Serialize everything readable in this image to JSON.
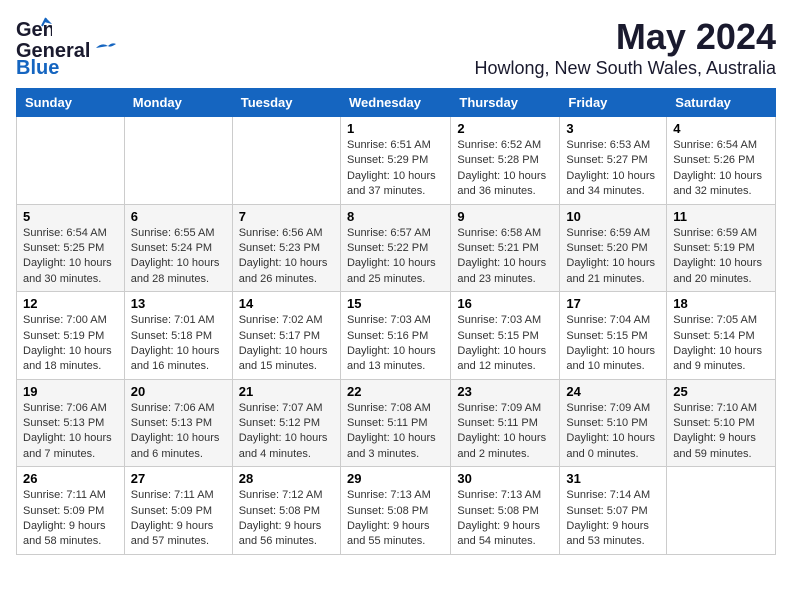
{
  "header": {
    "logo_line1": "General",
    "logo_line2": "Blue",
    "title": "May 2024",
    "subtitle": "Howlong, New South Wales, Australia"
  },
  "columns": [
    "Sunday",
    "Monday",
    "Tuesday",
    "Wednesday",
    "Thursday",
    "Friday",
    "Saturday"
  ],
  "weeks": [
    [
      {
        "day": "",
        "info": ""
      },
      {
        "day": "",
        "info": ""
      },
      {
        "day": "",
        "info": ""
      },
      {
        "day": "1",
        "info": "Sunrise: 6:51 AM\nSunset: 5:29 PM\nDaylight: 10 hours\nand 37 minutes."
      },
      {
        "day": "2",
        "info": "Sunrise: 6:52 AM\nSunset: 5:28 PM\nDaylight: 10 hours\nand 36 minutes."
      },
      {
        "day": "3",
        "info": "Sunrise: 6:53 AM\nSunset: 5:27 PM\nDaylight: 10 hours\nand 34 minutes."
      },
      {
        "day": "4",
        "info": "Sunrise: 6:54 AM\nSunset: 5:26 PM\nDaylight: 10 hours\nand 32 minutes."
      }
    ],
    [
      {
        "day": "5",
        "info": "Sunrise: 6:54 AM\nSunset: 5:25 PM\nDaylight: 10 hours\nand 30 minutes."
      },
      {
        "day": "6",
        "info": "Sunrise: 6:55 AM\nSunset: 5:24 PM\nDaylight: 10 hours\nand 28 minutes."
      },
      {
        "day": "7",
        "info": "Sunrise: 6:56 AM\nSunset: 5:23 PM\nDaylight: 10 hours\nand 26 minutes."
      },
      {
        "day": "8",
        "info": "Sunrise: 6:57 AM\nSunset: 5:22 PM\nDaylight: 10 hours\nand 25 minutes."
      },
      {
        "day": "9",
        "info": "Sunrise: 6:58 AM\nSunset: 5:21 PM\nDaylight: 10 hours\nand 23 minutes."
      },
      {
        "day": "10",
        "info": "Sunrise: 6:59 AM\nSunset: 5:20 PM\nDaylight: 10 hours\nand 21 minutes."
      },
      {
        "day": "11",
        "info": "Sunrise: 6:59 AM\nSunset: 5:19 PM\nDaylight: 10 hours\nand 20 minutes."
      }
    ],
    [
      {
        "day": "12",
        "info": "Sunrise: 7:00 AM\nSunset: 5:19 PM\nDaylight: 10 hours\nand 18 minutes."
      },
      {
        "day": "13",
        "info": "Sunrise: 7:01 AM\nSunset: 5:18 PM\nDaylight: 10 hours\nand 16 minutes."
      },
      {
        "day": "14",
        "info": "Sunrise: 7:02 AM\nSunset: 5:17 PM\nDaylight: 10 hours\nand 15 minutes."
      },
      {
        "day": "15",
        "info": "Sunrise: 7:03 AM\nSunset: 5:16 PM\nDaylight: 10 hours\nand 13 minutes."
      },
      {
        "day": "16",
        "info": "Sunrise: 7:03 AM\nSunset: 5:15 PM\nDaylight: 10 hours\nand 12 minutes."
      },
      {
        "day": "17",
        "info": "Sunrise: 7:04 AM\nSunset: 5:15 PM\nDaylight: 10 hours\nand 10 minutes."
      },
      {
        "day": "18",
        "info": "Sunrise: 7:05 AM\nSunset: 5:14 PM\nDaylight: 10 hours\nand 9 minutes."
      }
    ],
    [
      {
        "day": "19",
        "info": "Sunrise: 7:06 AM\nSunset: 5:13 PM\nDaylight: 10 hours\nand 7 minutes."
      },
      {
        "day": "20",
        "info": "Sunrise: 7:06 AM\nSunset: 5:13 PM\nDaylight: 10 hours\nand 6 minutes."
      },
      {
        "day": "21",
        "info": "Sunrise: 7:07 AM\nSunset: 5:12 PM\nDaylight: 10 hours\nand 4 minutes."
      },
      {
        "day": "22",
        "info": "Sunrise: 7:08 AM\nSunset: 5:11 PM\nDaylight: 10 hours\nand 3 minutes."
      },
      {
        "day": "23",
        "info": "Sunrise: 7:09 AM\nSunset: 5:11 PM\nDaylight: 10 hours\nand 2 minutes."
      },
      {
        "day": "24",
        "info": "Sunrise: 7:09 AM\nSunset: 5:10 PM\nDaylight: 10 hours\nand 0 minutes."
      },
      {
        "day": "25",
        "info": "Sunrise: 7:10 AM\nSunset: 5:10 PM\nDaylight: 9 hours\nand 59 minutes."
      }
    ],
    [
      {
        "day": "26",
        "info": "Sunrise: 7:11 AM\nSunset: 5:09 PM\nDaylight: 9 hours\nand 58 minutes."
      },
      {
        "day": "27",
        "info": "Sunrise: 7:11 AM\nSunset: 5:09 PM\nDaylight: 9 hours\nand 57 minutes."
      },
      {
        "day": "28",
        "info": "Sunrise: 7:12 AM\nSunset: 5:08 PM\nDaylight: 9 hours\nand 56 minutes."
      },
      {
        "day": "29",
        "info": "Sunrise: 7:13 AM\nSunset: 5:08 PM\nDaylight: 9 hours\nand 55 minutes."
      },
      {
        "day": "30",
        "info": "Sunrise: 7:13 AM\nSunset: 5:08 PM\nDaylight: 9 hours\nand 54 minutes."
      },
      {
        "day": "31",
        "info": "Sunrise: 7:14 AM\nSunset: 5:07 PM\nDaylight: 9 hours\nand 53 minutes."
      },
      {
        "day": "",
        "info": ""
      }
    ]
  ]
}
